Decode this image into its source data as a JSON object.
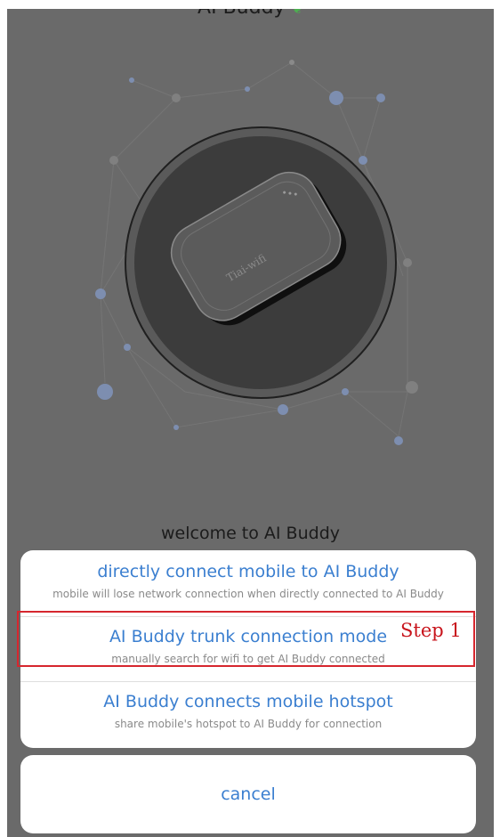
{
  "app": {
    "title": "AI Buddy",
    "welcome": "welcome to AI Buddy",
    "device_label": "Tiai-wifi"
  },
  "options": [
    {
      "title": "directly connect mobile to AI Buddy",
      "subtitle": "mobile will lose network connection when directly connected to AI Buddy"
    },
    {
      "title": "AI Buddy trunk connection mode",
      "subtitle": "manually search for wifi to get AI Buddy connected"
    },
    {
      "title": "AI Buddy connects mobile hotspot",
      "subtitle": "share mobile's hotspot to AI Buddy for connection"
    }
  ],
  "cancel_label": "cancel",
  "annotation": {
    "label": "Step 1",
    "color": "#d6262e"
  },
  "colors": {
    "accent": "#3b7fd0",
    "overlay": "#6a6a6a",
    "sheet": "#ffffff"
  },
  "icons": {
    "title_leaf": "leaf-icon"
  }
}
